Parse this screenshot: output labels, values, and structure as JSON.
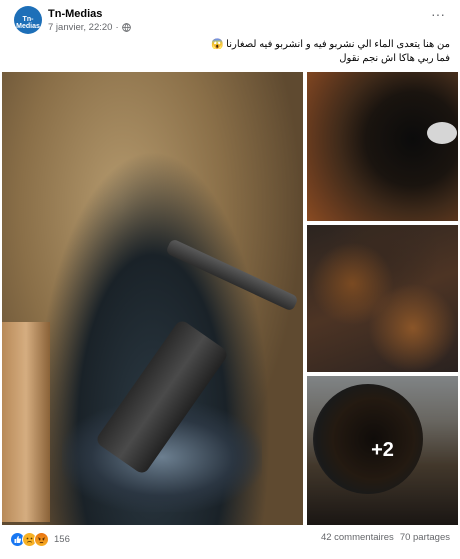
{
  "post": {
    "page_name": "Tn-Medias",
    "avatar_text": "Tn-Medias",
    "timestamp": "7 janvier, 22:20",
    "separator": "·",
    "text_line1": "من هنا يتعدى الماء الي نشربو فيه و انشربو  فيه لصغارنا 😱",
    "text_line2": "فما ربي هاكا اش نجم نقول"
  },
  "media": {
    "extra_photos": "+2"
  },
  "footer": {
    "reaction_count": "156",
    "comments": "42 commentaires",
    "shares": "70 partages"
  },
  "reaction_icons": [
    "like-icon",
    "sad-icon",
    "angry-icon"
  ],
  "colors": {
    "brand_blue": "#1877f2",
    "avatar_blue": "#1d6fb8",
    "muted_text": "#65676b"
  }
}
